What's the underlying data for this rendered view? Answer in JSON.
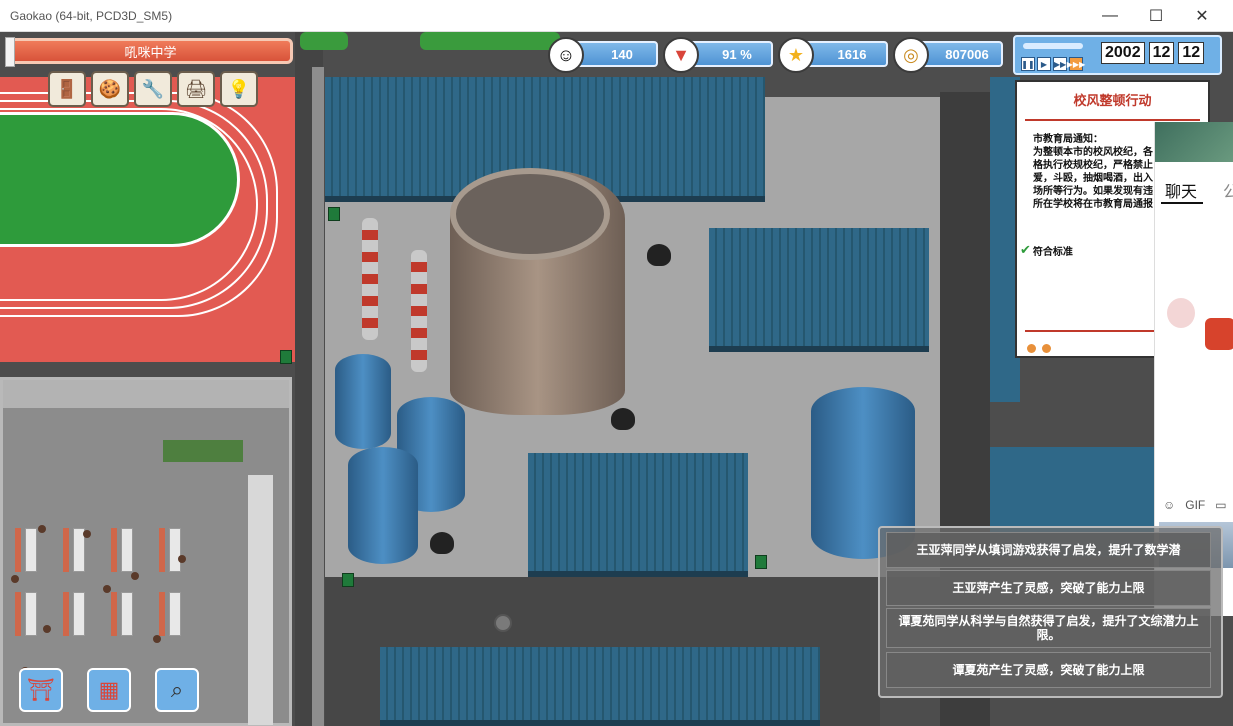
{
  "window": {
    "title": "Gaokao (64-bit, PCD3D_SM5)",
    "minimize_glyph": "—",
    "maximize_glyph": "☐",
    "close_glyph": "✕"
  },
  "hud": {
    "school_name": "吼咪中学",
    "tools": [
      {
        "icon": "door-icon",
        "glyph": "🚪"
      },
      {
        "icon": "cookies-icon",
        "glyph": "🍪"
      },
      {
        "icon": "tools-icon",
        "glyph": "🔧"
      },
      {
        "icon": "printer-icon",
        "glyph": "🖨"
      },
      {
        "icon": "lightbulb-icon",
        "glyph": "💡"
      }
    ],
    "stats": {
      "students": "140",
      "approval": "91 %",
      "reputation": "1616",
      "money": "807006"
    },
    "date": {
      "year": "2002",
      "month": "12",
      "day": "12"
    },
    "speed_buttons": [
      "❚❚",
      "▶",
      "▶▶",
      "▶▶▶"
    ]
  },
  "notice": {
    "title": "校风整顿行动",
    "body_lines": [
      "市教育局通知：",
      "为整顿本市的校风校纪，各",
      "格执行校规校纪，严格禁止",
      "爱，斗殴，抽烟喝酒，出入",
      "场所等行为。如果发现有违",
      "所在学校将在市教育局通报"
    ],
    "status": "符合标准"
  },
  "chat": {
    "tab_chat": "聊天",
    "tab_other": "公",
    "tools": [
      "☺",
      "GIF",
      "▭"
    ]
  },
  "event_log": [
    "王亚萍同学从填词游戏获得了启发，提升了数学潜",
    "王亚萍产生了灵感，突破了能力上限",
    "谭夏苑同学从科学与自然获得了启发，提升了文综潜力上限。",
    "谭夏苑产生了灵感，突破了能力上限"
  ],
  "bottom_buttons": [
    {
      "icon": "desk-icon",
      "glyph": "⛩"
    },
    {
      "icon": "calendar-icon",
      "glyph": "▦"
    },
    {
      "icon": "magnifier-icon",
      "glyph": "⌕"
    }
  ]
}
